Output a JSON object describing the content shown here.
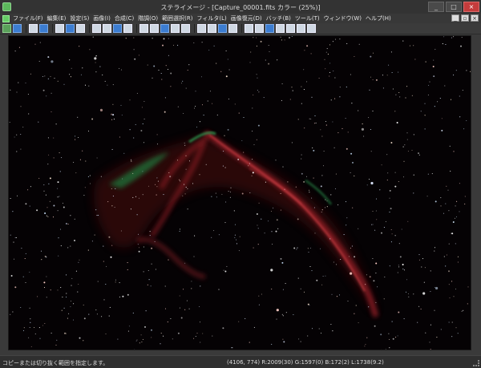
{
  "window": {
    "title": "ステライメージ - [Capture_00001.fits カラー (25%)]",
    "controls": [
      "_",
      "□",
      "×"
    ]
  },
  "menubar": {
    "items": [
      "ファイル(F)",
      "編集(E)",
      "設定(S)",
      "画像(I)",
      "合成(C)",
      "階調(O)",
      "範囲選択(R)",
      "フィルタ(L)",
      "画像復元(D)",
      "バッチ(B)",
      "ツール(T)",
      "ウィンドウ(W)",
      "ヘルプ(H)"
    ],
    "mdi_controls": [
      "_",
      "▫",
      "×"
    ]
  },
  "toolbar": {
    "buttons": [
      "open-icon",
      "save-icon",
      "undo-icon",
      "info-icon",
      "levels-icon",
      "histogram-icon",
      "color-icon",
      "compose-icon",
      "filter-icon",
      "restore-icon",
      "batch-icon",
      "zoom-in-icon",
      "zoom-out-icon",
      "fit-icon",
      "select-icon",
      "crop-icon"
    ]
  },
  "image": {
    "filename": "Capture_00001.fits",
    "zoom": "25%",
    "subject": "網状星雲 (NGC 6992)"
  },
  "statusbar": {
    "hint": "コピーまたは切り抜く範囲を指定します。",
    "readout": "(4106, 774) R:2009(30) G:1597(0) B:172(2) L:1738(9.2)"
  },
  "colors": {
    "background": "#050204",
    "nebula_red": "#b0242a",
    "nebula_green": "#2f9c4f",
    "star": "#ffffff"
  }
}
